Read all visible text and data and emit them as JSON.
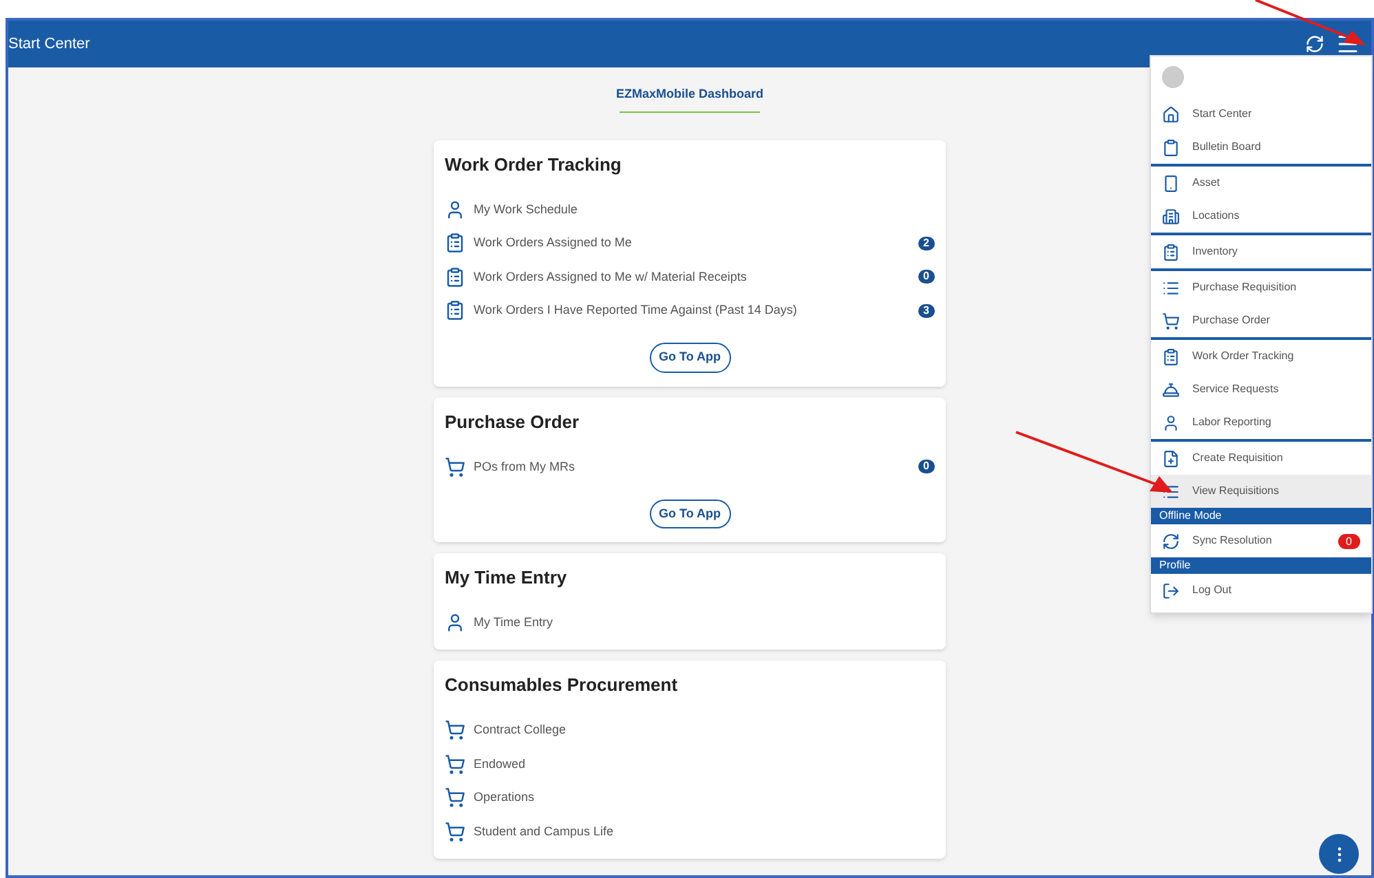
{
  "header": {
    "title": "Start Center"
  },
  "dashboard_tab": {
    "label": "EZMaxMobile Dashboard",
    "selected": true
  },
  "cards": [
    {
      "title": "Work Order Tracking",
      "items": [
        {
          "kind": "person",
          "label": "My Work Schedule"
        },
        {
          "kind": "clipboard",
          "label": "Work Orders Assigned to Me",
          "count": "2"
        },
        {
          "kind": "clipboard",
          "label": "Work Orders Assigned to Me w/ Material Receipts",
          "count": "0"
        },
        {
          "kind": "clipboard",
          "label": "Work Orders I Have Reported Time Against (Past 14 Days)",
          "count": "3"
        }
      ],
      "button": "Go To App"
    },
    {
      "title": "Purchase Order",
      "items": [
        {
          "kind": "cart",
          "label": "POs from My MRs",
          "count": "0"
        }
      ],
      "button": "Go To App"
    },
    {
      "title": "My Time Entry",
      "items": [
        {
          "kind": "person",
          "label": "My Time Entry"
        }
      ]
    },
    {
      "title": "Consumables Procurement",
      "items": [
        {
          "kind": "cart",
          "label": "Contract College"
        },
        {
          "kind": "cart",
          "label": "Endowed"
        },
        {
          "kind": "cart",
          "label": "Operations"
        },
        {
          "kind": "cart",
          "label": "Student and Campus Life"
        }
      ]
    }
  ],
  "menu": {
    "groups": [
      {
        "items": [
          {
            "kind": "home",
            "label": "Start Center",
            "selected": false
          },
          {
            "kind": "board",
            "label": "Bulletin Board",
            "selected": false
          }
        ]
      },
      {
        "items": [
          {
            "kind": "asset",
            "label": "Asset",
            "selected": false
          },
          {
            "kind": "building",
            "label": "Locations",
            "selected": false
          }
        ]
      },
      {
        "items": [
          {
            "kind": "clipboard",
            "label": "Inventory",
            "selected": false
          }
        ]
      },
      {
        "items": [
          {
            "kind": "list",
            "label": "Purchase Requisition",
            "selected": false
          },
          {
            "kind": "cart",
            "label": "Purchase Order",
            "selected": false
          }
        ]
      },
      {
        "items": [
          {
            "kind": "clipboard",
            "label": "Work Order Tracking",
            "selected": false
          },
          {
            "kind": "bell",
            "label": "Service Requests",
            "selected": false
          },
          {
            "kind": "person",
            "label": "Labor Reporting",
            "selected": false
          }
        ]
      },
      {
        "items": [
          {
            "kind": "fileplus",
            "label": "Create Requisition",
            "selected": false
          },
          {
            "kind": "list",
            "label": "View Requisitions",
            "selected": true
          }
        ]
      },
      {
        "heading": "Offline Mode",
        "items": [
          {
            "kind": "sync",
            "label": "Sync Resolution",
            "selected": false,
            "count": "0"
          }
        ]
      },
      {
        "heading": "Profile",
        "items": [
          {
            "kind": "logout",
            "label": "Log Out",
            "selected": false
          }
        ]
      }
    ]
  }
}
